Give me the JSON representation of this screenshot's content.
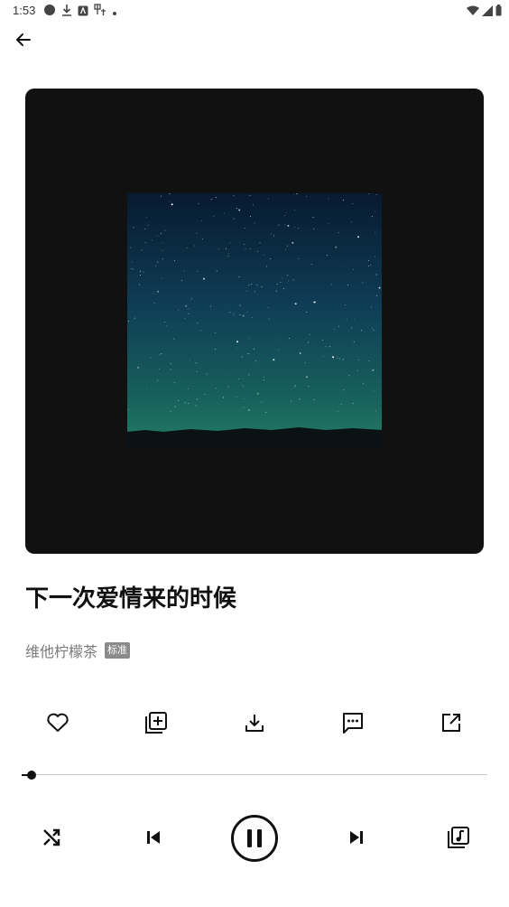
{
  "status_bar": {
    "time": "1:53",
    "left_icons": [
      "record-dot-icon",
      "download-icon",
      "notification-app-icon",
      "translate-icon",
      "small-dot-icon"
    ],
    "right_icons": [
      "wifi-icon",
      "signal-icon",
      "battery-icon"
    ]
  },
  "header": {
    "back_icon": "arrow-left-icon"
  },
  "track": {
    "title": "下一次爱情来的时候",
    "artist": "维他柠檬茶",
    "quality_badge": "标准"
  },
  "actions": [
    {
      "name": "like",
      "icon": "heart-outline-icon"
    },
    {
      "name": "add-to-playlist",
      "icon": "playlist-add-icon"
    },
    {
      "name": "download",
      "icon": "download-icon"
    },
    {
      "name": "comments",
      "icon": "comment-icon"
    },
    {
      "name": "share",
      "icon": "open-external-icon"
    }
  ],
  "progress": {
    "fraction": 0.02
  },
  "controls": [
    {
      "name": "shuffle",
      "icon": "shuffle-icon"
    },
    {
      "name": "previous",
      "icon": "skip-previous-icon"
    },
    {
      "name": "pause",
      "icon": "pause-circle-icon"
    },
    {
      "name": "next",
      "icon": "skip-next-icon"
    },
    {
      "name": "queue",
      "icon": "queue-music-icon"
    }
  ],
  "colors": {
    "artwork_background": "#111111",
    "sky_top": "#071a30",
    "sky_bottom": "#1d6b5e",
    "accent": "#111111"
  }
}
